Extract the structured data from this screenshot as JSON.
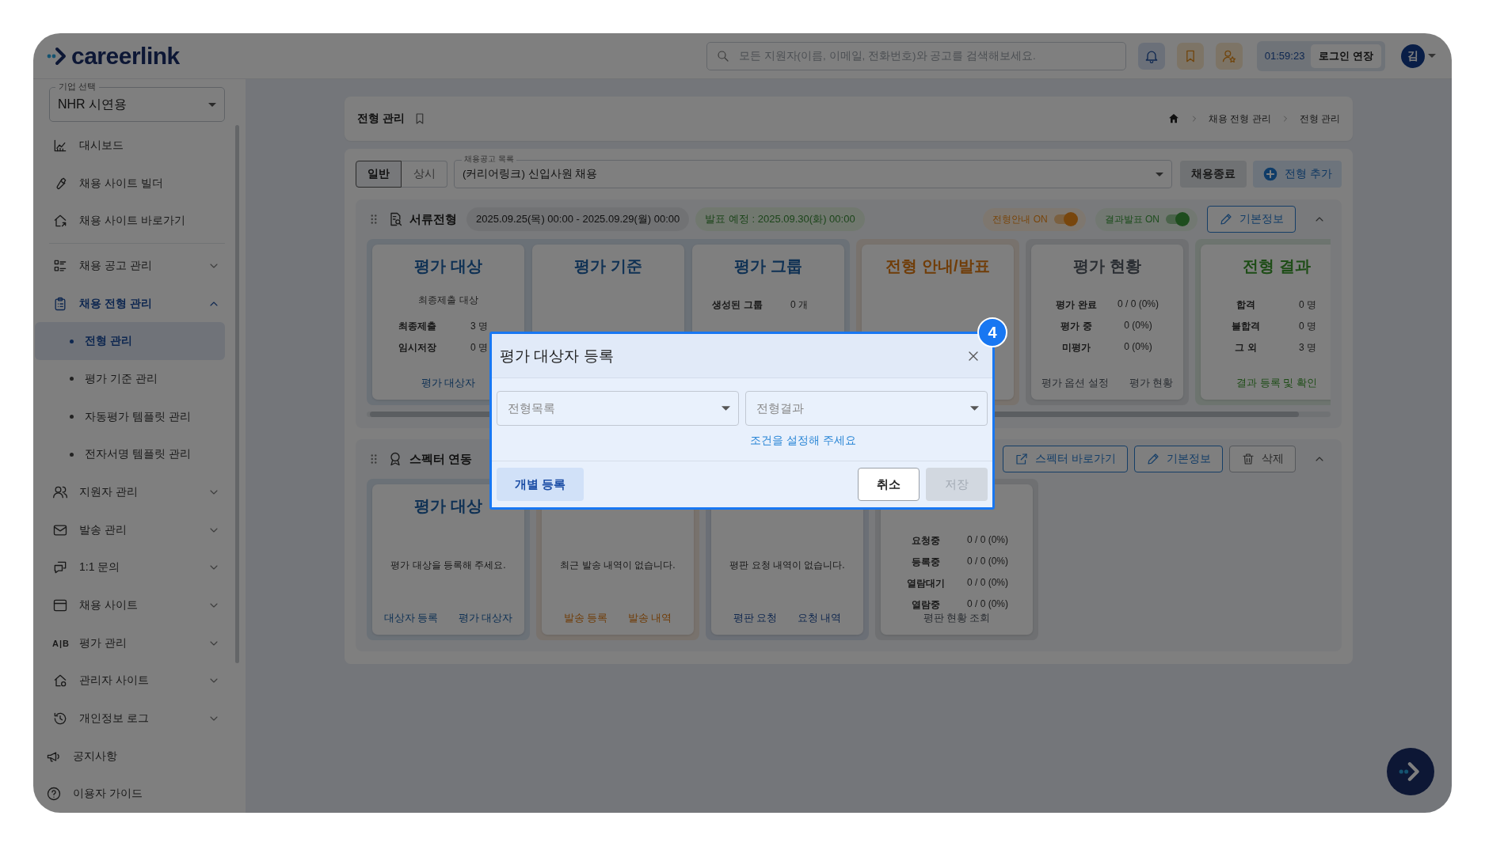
{
  "logo": {
    "text": "careerlink"
  },
  "search": {
    "placeholder": "모든 지원자(이름, 이메일, 전화번호)와 공고를 검색해보세요."
  },
  "session": {
    "timer": "01:59:23",
    "extend_button": "로그인 연장"
  },
  "user": {
    "initial": "김"
  },
  "company_select": {
    "label": "기업 선택",
    "value": "NHR 시연용"
  },
  "sidebar": {
    "sections": [
      {
        "items": [
          {
            "label": "대시보드"
          },
          {
            "label": "채용 사이트 빌더"
          },
          {
            "label": "채용 사이트 바로가기"
          }
        ]
      },
      {
        "items": [
          {
            "label": "채용 공고 관리",
            "expanded": false
          },
          {
            "label": "채용 전형 관리",
            "expanded": true,
            "children": [
              {
                "label": "전형 관리",
                "selected": true
              },
              {
                "label": "평가 기준 관리",
                "selected": false
              },
              {
                "label": "자동평가 템플릿 관리",
                "selected": false
              },
              {
                "label": "전자서명 템플릿 관리",
                "selected": false
              }
            ]
          },
          {
            "label": "지원자 관리",
            "expanded": false
          },
          {
            "label": "발송 관리",
            "expanded": false
          },
          {
            "label": "1:1 문의",
            "expanded": false
          },
          {
            "label": "채용 사이트",
            "expanded": false
          },
          {
            "label": "평가 관리",
            "expanded": false,
            "icon_text": "A|B"
          },
          {
            "label": "관리자 사이트",
            "expanded": false
          },
          {
            "label": "개인정보 로그",
            "expanded": false
          }
        ]
      }
    ],
    "footer": [
      {
        "label": "공지사항"
      },
      {
        "label": "이용자 가이드"
      }
    ]
  },
  "page_header": {
    "title": "전형 관리",
    "breadcrumb": [
      "채용 전형 관리",
      "전형 관리"
    ]
  },
  "toolbar": {
    "tabs": [
      {
        "label": "일반",
        "selected": true
      },
      {
        "label": "상시",
        "selected": false
      }
    ],
    "posting_select": {
      "label": "채용공고 목록",
      "value": "(커리어링크) 신입사원 채용"
    },
    "end_button": "채용종료",
    "add_button": "전형 추가"
  },
  "stages": [
    {
      "name": "서류전형",
      "period": "2025.09.25(목) 00:00 - 2025.09.29(월) 00:00",
      "announce": "발표 예정 : 2025.09.30(화) 00:00",
      "toggles": [
        {
          "label": "전형안내 ON",
          "on": true,
          "color": "#78460d"
        },
        {
          "label": "결과발표 ON",
          "on": true,
          "color": "#1e4d1e"
        }
      ],
      "buttons": [
        {
          "kind": "edit",
          "label": "기본정보"
        }
      ],
      "expanded": true,
      "groups": [
        [
          {
            "title": "평가 대상",
            "kind": "evaluation",
            "subtitle": "최종제출 대상",
            "rows": [
              [
                "최종제출",
                "3 명"
              ],
              [
                "임시저장",
                "0 명"
              ]
            ],
            "links": [
              "평가 대상자"
            ]
          },
          {
            "title": "평가 기준",
            "kind": "evaluation"
          },
          {
            "title": "평가 그룹",
            "kind": "evaluation",
            "rows": [
              [
                "생성된 그룹",
                "0 개"
              ]
            ]
          }
        ],
        [
          {
            "title": "전형 안내/발표",
            "kind": "notice"
          }
        ],
        [
          {
            "title": "평가 현황",
            "kind": "status",
            "rows": [
              [
                "평가 완료",
                "0 / 0 (0%)"
              ],
              [
                "평가 중",
                "0 (0%)"
              ],
              [
                "미평가",
                "0 (0%)"
              ]
            ],
            "links": [
              "평가 옵션 설정",
              "평가 현황"
            ]
          }
        ],
        [
          {
            "title": "전형 결과",
            "kind": "result",
            "rows": [
              [
                "합격",
                "0 명"
              ],
              [
                "불합격",
                "0 명"
              ],
              [
                "그 외",
                "3 명"
              ]
            ],
            "links": [
              "결과 등록 및 확인"
            ]
          }
        ]
      ]
    },
    {
      "name": "스펙터 연동",
      "buttons": [
        {
          "kind": "external",
          "label": "스펙터 바로가기"
        },
        {
          "kind": "edit",
          "label": "기본정보"
        },
        {
          "kind": "delete",
          "label": "삭제"
        }
      ],
      "expanded": true,
      "groups": [
        [
          {
            "title": "평가 대상",
            "kind": "evaluation",
            "message": "평가 대상을 등록해 주세요.",
            "links": [
              "대상자 등록",
              "평가 대상자"
            ]
          }
        ],
        [
          {
            "kind": "notice",
            "message": "최근 발송 내역이 없습니다.",
            "links": [
              "발송 등록",
              "발송 내역"
            ]
          }
        ],
        [
          {
            "kind": "reference",
            "message": "평판 요청 내역이 없습니다.",
            "links": [
              "평판 요청",
              "요청 내역"
            ]
          }
        ],
        [
          {
            "kind": "status",
            "rows": [
              [
                "요청중",
                "0 / 0 (0%)"
              ],
              [
                "등록중",
                "0 / 0 (0%)"
              ],
              [
                "열람대기",
                "0 / 0 (0%)"
              ],
              [
                "열람중",
                "0 / 0 (0%)"
              ]
            ],
            "links": [
              "평판 현황 조회"
            ]
          }
        ]
      ]
    }
  ],
  "modal": {
    "step": "4",
    "title": "평가 대상자 등록",
    "selects": [
      {
        "placeholder": "전형목록"
      },
      {
        "placeholder": "전형결과"
      }
    ],
    "hint": "조건을 설정해 주세요",
    "buttons": [
      {
        "kind": "secondary",
        "label": "개별 등록",
        "disabled": false
      },
      {
        "kind": "cancel",
        "label": "취소",
        "disabled": false
      },
      {
        "kind": "primary",
        "label": "저장",
        "disabled": true
      }
    ]
  }
}
